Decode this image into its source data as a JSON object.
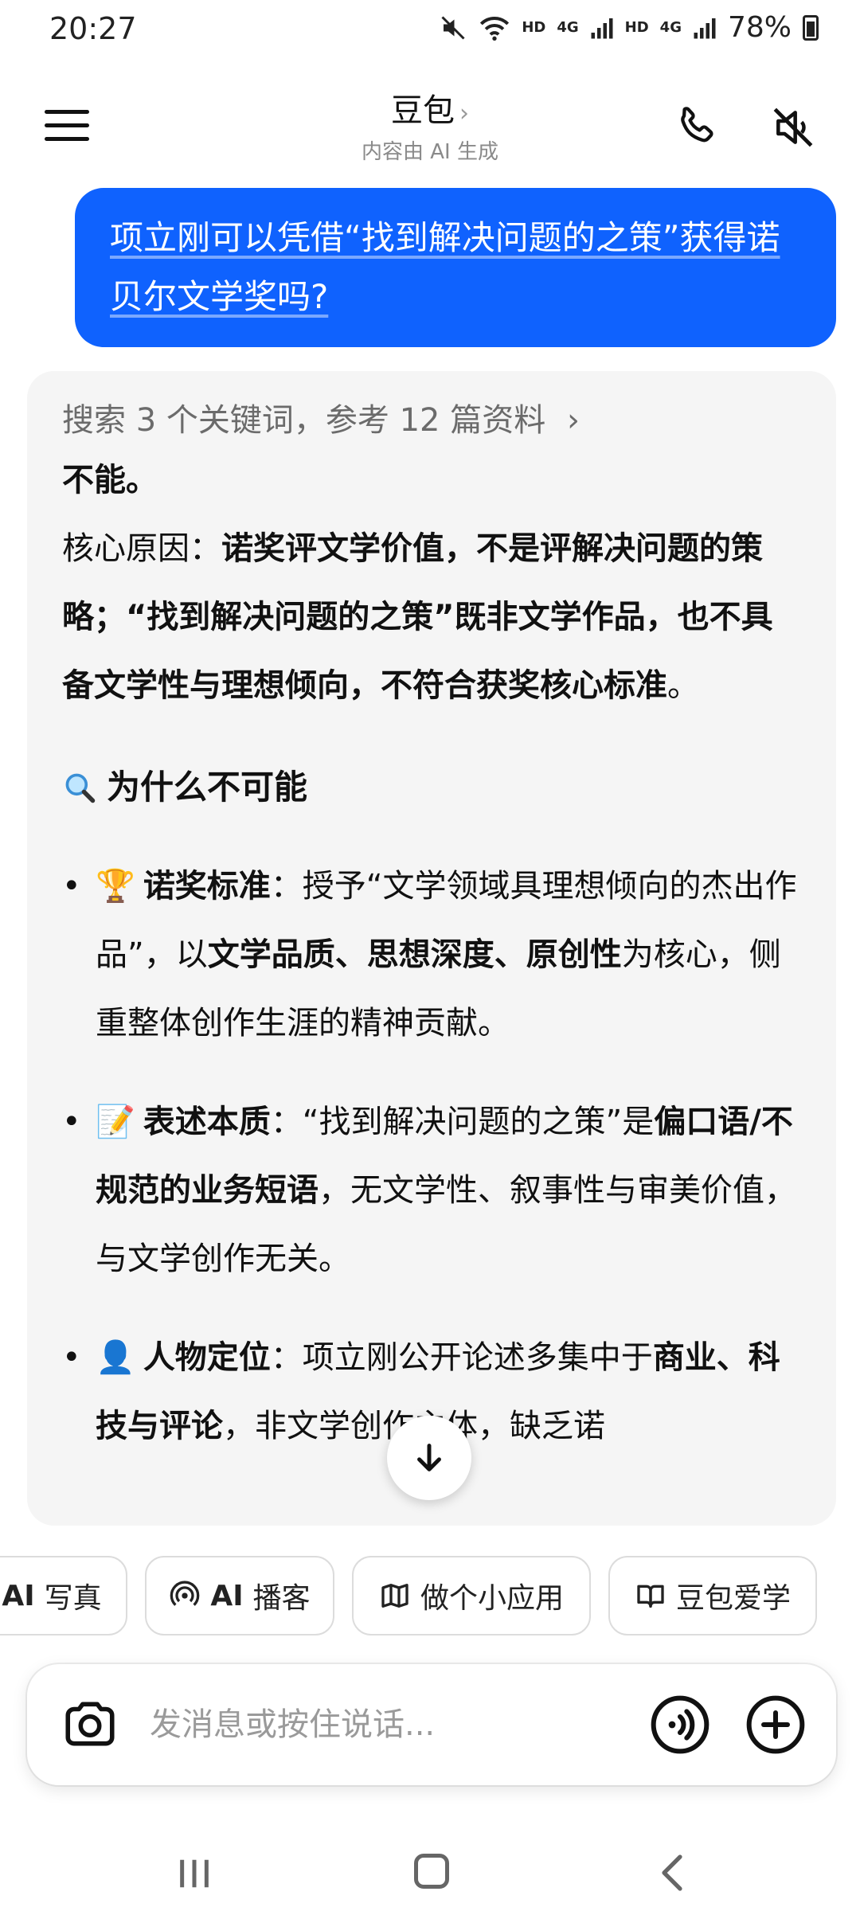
{
  "status_bar": {
    "time": "20:27",
    "hd1": "HD",
    "sig1": "4G",
    "hd2": "HD",
    "sig2": "4G",
    "battery": "78%"
  },
  "header": {
    "title": "豆包",
    "subtitle": "内容由 AI 生成"
  },
  "user_message": {
    "text": "项立刚可以凭借“找到解决问题的之策”获得诺贝尔文学奖吗?"
  },
  "answer": {
    "search_ref": "搜索 3 个关键词，参考 12 篇资料",
    "verdict": "不能。",
    "core_label": "核心原因：",
    "core_text": "诺奖评文学价值，不是评解决问题的策略；“找到解决问题的之策”既非文学作品，也不具备文学性与理想倾向，不符合获奖核心标准",
    "core_end": "。",
    "section_title": "为什么不可能",
    "bullets": [
      {
        "icon": "trophy-icon",
        "title": "诺奖标准",
        "p1": "：授予“文学领域具理想倾向的杰出作品”，以",
        "bold": "文学品质、思想深度、原创性",
        "p2": "为核心，侧重整体创作生涯的精神贡献。"
      },
      {
        "icon": "memo-icon",
        "title": "表述本质",
        "p1": "：“找到解决问题的之策”是",
        "bold": "偏口语/不规范的业务短语",
        "p2": "，无文学性、叙事性与审美价值，与文学创作无关。"
      },
      {
        "icon": "person-icon",
        "title": "人物定位",
        "p1": "：项立刚公开论述多集中于",
        "bold": "商业、科技与评论",
        "p2": "，非文学创作主体，缺乏诺"
      }
    ]
  },
  "chips": [
    {
      "ai": "AI",
      "label": "写真"
    },
    {
      "ai": "AI",
      "label": "播客"
    },
    {
      "label": "做个小应用"
    },
    {
      "label": "豆包爱学"
    }
  ],
  "input": {
    "placeholder": "发消息或按住说话..."
  },
  "colors": {
    "accent": "#0f62fe",
    "answer_bg": "#f5f5f5"
  }
}
